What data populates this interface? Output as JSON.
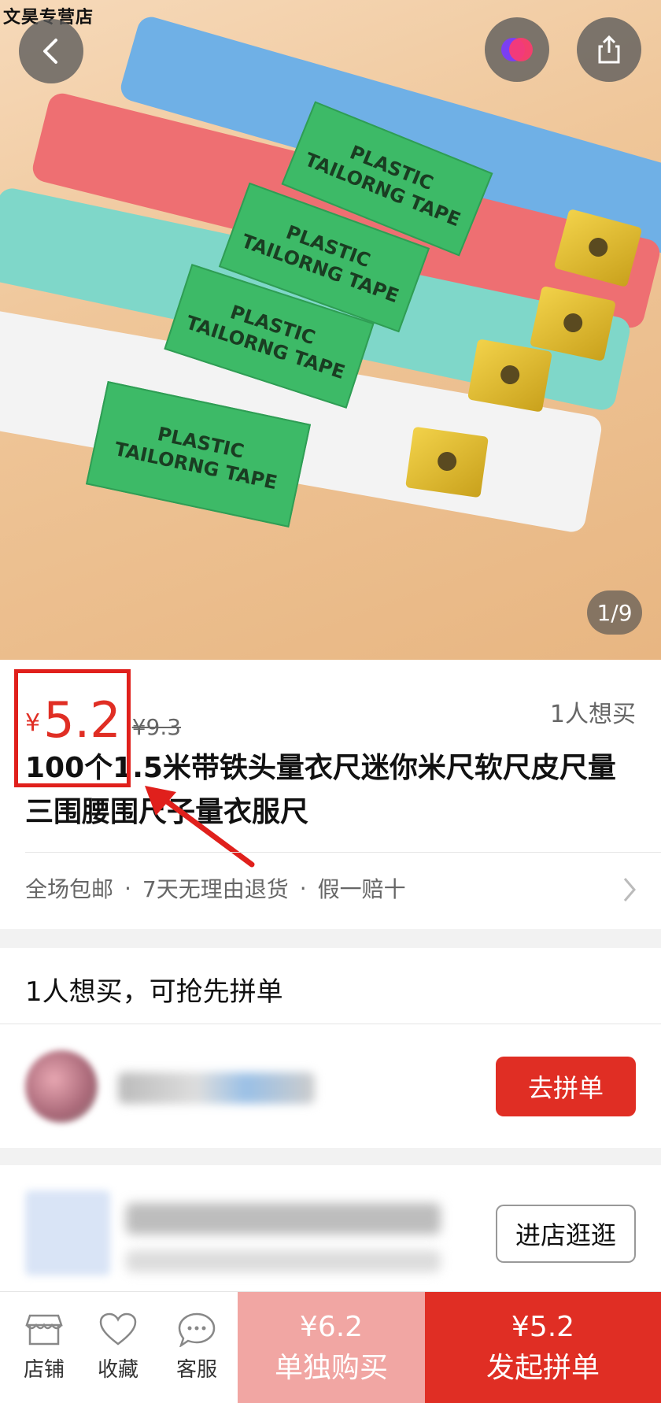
{
  "hero": {
    "watermark": "文昊专营店",
    "page_indicator": "1/9"
  },
  "tapes": [
    {
      "line1": "PLASTIC",
      "line2": "TAILORNG TAPE"
    },
    {
      "line1": "PLASTIC",
      "line2": "TAILORNG TAPE"
    },
    {
      "line1": "PLASTIC",
      "line2": "TAILORNG TAPE"
    },
    {
      "line1": "PLASTIC",
      "line2": "TAILORNG TAPE"
    }
  ],
  "product": {
    "currency": "¥",
    "price": "5.2",
    "original_price": "¥9.3",
    "want_count": "1人想买",
    "title": "100个1.5米带铁头量衣尺迷你米尺软尺皮尺量三围腰围尺子量衣服尺",
    "services": [
      "全场包邮",
      "7天无理由退货",
      "假一赔十"
    ],
    "service_separator": "·"
  },
  "groups": {
    "title": "1人想买，可抢先拼单",
    "join_label": "去拼单"
  },
  "store": {
    "visit_label": "进店逛逛"
  },
  "bottom_bar": {
    "shop": "店铺",
    "favorite": "收藏",
    "service": "客服",
    "single_price": "¥6.2",
    "single_label": "单独购买",
    "group_price": "¥5.2",
    "group_label": "发起拼单"
  },
  "colors": {
    "accent": "#e02e24",
    "single_bg": "#f1a6a3",
    "annotation": "#e0201c"
  }
}
